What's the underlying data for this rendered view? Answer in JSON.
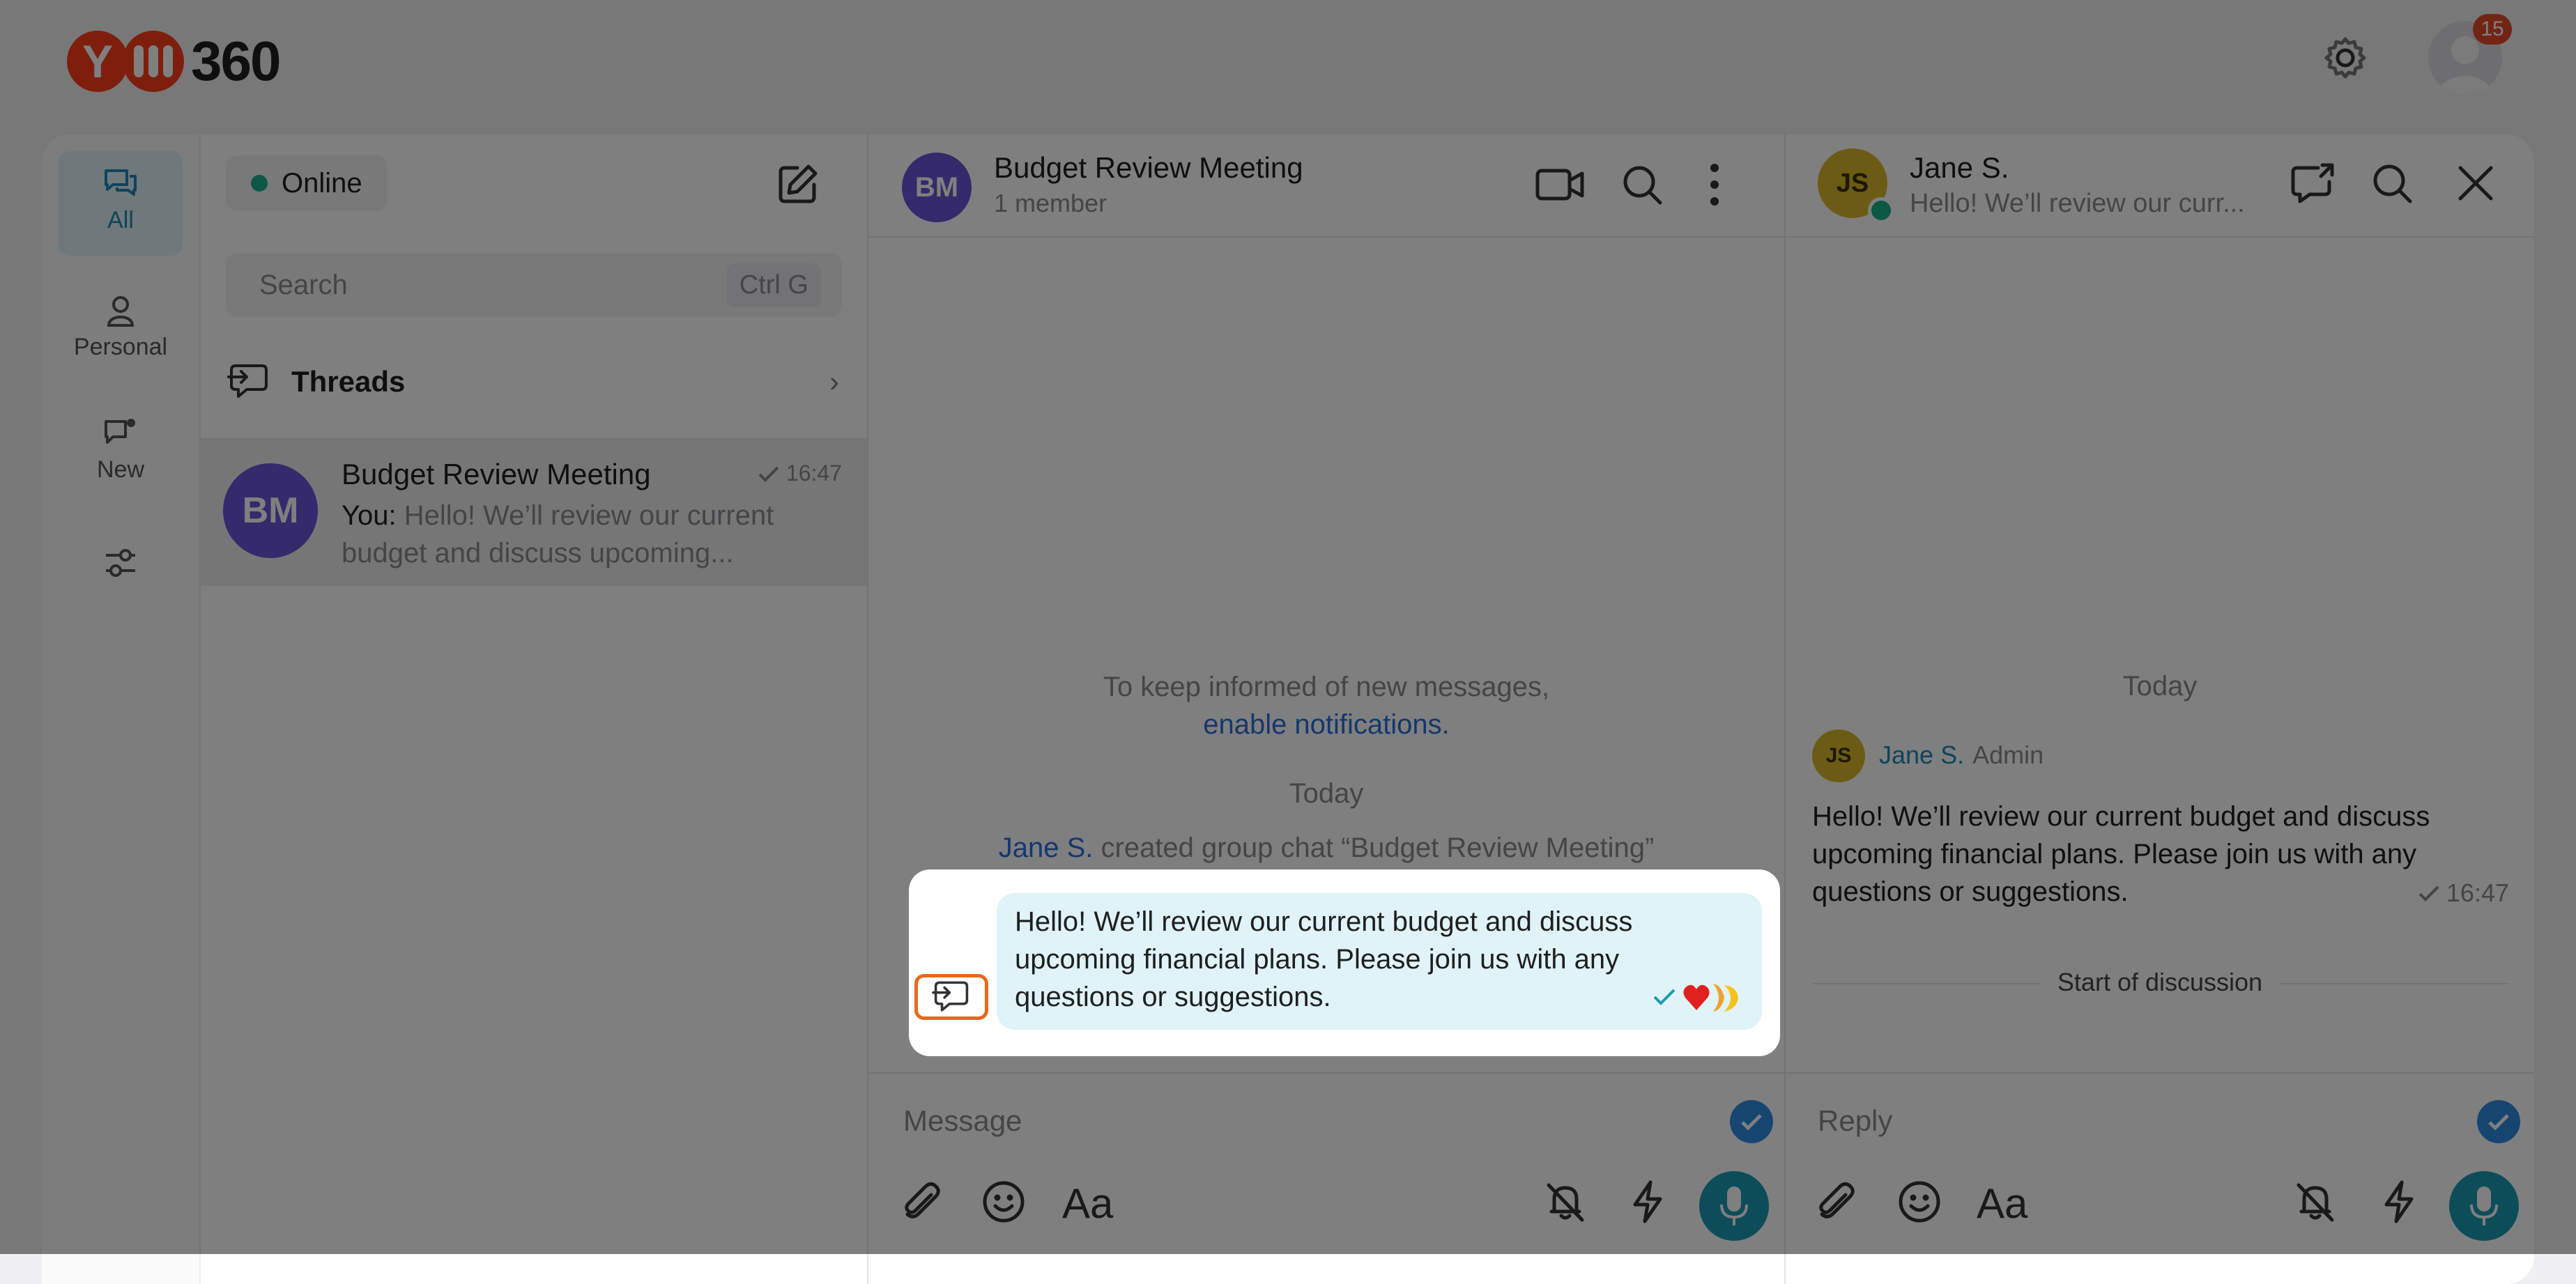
{
  "header": {
    "logo_text": "360",
    "notification_count": "15"
  },
  "rail": {
    "items": [
      {
        "label": "All"
      },
      {
        "label": "Personal"
      },
      {
        "label": "New"
      }
    ]
  },
  "chat_list": {
    "status": "Online",
    "search_placeholder": "Search",
    "search_shortcut": "Ctrl G",
    "threads_label": "Threads",
    "chats": [
      {
        "initials": "BM",
        "name": "Budget Review Meeting",
        "time": "16:47",
        "sender": "You:",
        "preview_line1": "Hello! We’ll review our current",
        "preview_line2": "budget and discuss upcoming..."
      }
    ]
  },
  "conversation": {
    "initials": "BM",
    "title": "Budget Review Meeting",
    "subtitle": "1 member",
    "notify_line1": "To keep informed of new messages,",
    "notify_link": "enable notifications.",
    "date_label": "Today",
    "system_author": "Jane S.",
    "system_text": "created group chat “Budget Review Meeting”",
    "message": {
      "line1": "Hello! We’ll review our current budget and discuss",
      "line2": "upcoming financial plans. Please join us with any",
      "line3": "questions or suggestions."
    },
    "composer_placeholder": "Message",
    "format_label": "Aa"
  },
  "thread": {
    "initials": "JS",
    "title": "Jane S.",
    "subtitle": "Hello! We’ll review our curr...",
    "date_label": "Today",
    "author": "Jane S.",
    "role": "Admin",
    "message": {
      "line1": "Hello! We’ll review our current budget and discuss",
      "line2": "upcoming financial plans. Please join us with any",
      "line3": "questions or suggestions."
    },
    "time": "16:47",
    "start_label": "Start of discussion",
    "reply_placeholder": "Reply",
    "format_label": "Aa"
  },
  "colors": {
    "accent": "#2a6fdb",
    "highlight": "#e66a1e",
    "bubble": "#dff3f8",
    "brand": "#fc3f1d",
    "avatar_bm": "#6a55d6",
    "avatar_js": "#d9b72a",
    "mic": "#1a9bb2"
  }
}
